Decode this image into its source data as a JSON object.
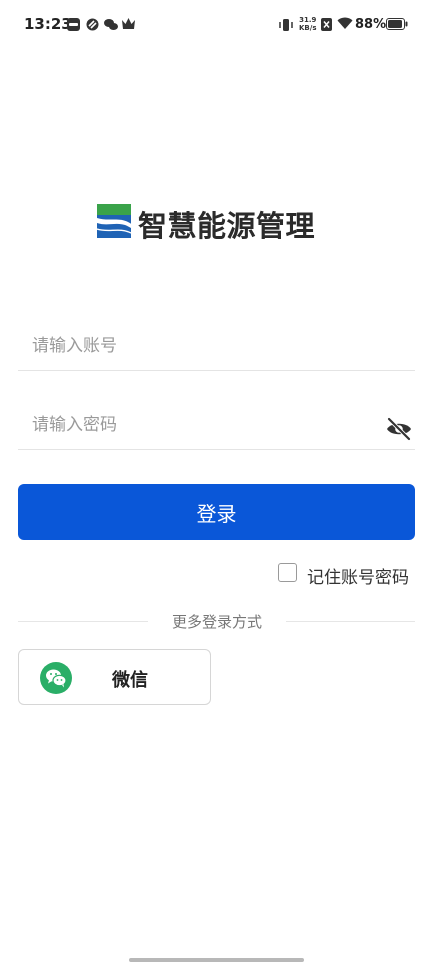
{
  "status_bar": {
    "time": "13:23",
    "net_speed_value": "31.9",
    "net_speed_unit": "KB/s",
    "battery_percent": "88%",
    "icons": [
      "notification-app-icon",
      "sync-app-icon",
      "wechat-notify-icon",
      "crown-app-icon",
      "vibrate-icon",
      "sim-off-icon",
      "wifi-icon",
      "battery-icon"
    ]
  },
  "logo": {
    "brand_name": "智慧能源管理",
    "mark_colors": {
      "green": "#3aa34a",
      "blue": "#1f63b5"
    }
  },
  "form": {
    "account_placeholder": "请输入账号",
    "account_value": "",
    "password_placeholder": "请输入密码",
    "password_value": "",
    "password_visibility_icon": "eye-off-icon",
    "login_label": "登录",
    "remember_label": "记住账号密码",
    "remember_checked": false
  },
  "other_login": {
    "divider_text": "更多登录方式",
    "wechat_label": "微信",
    "wechat_icon": "wechat-icon"
  },
  "colors": {
    "primary": "#0a57d8",
    "wechat_green": "#2aae67"
  }
}
